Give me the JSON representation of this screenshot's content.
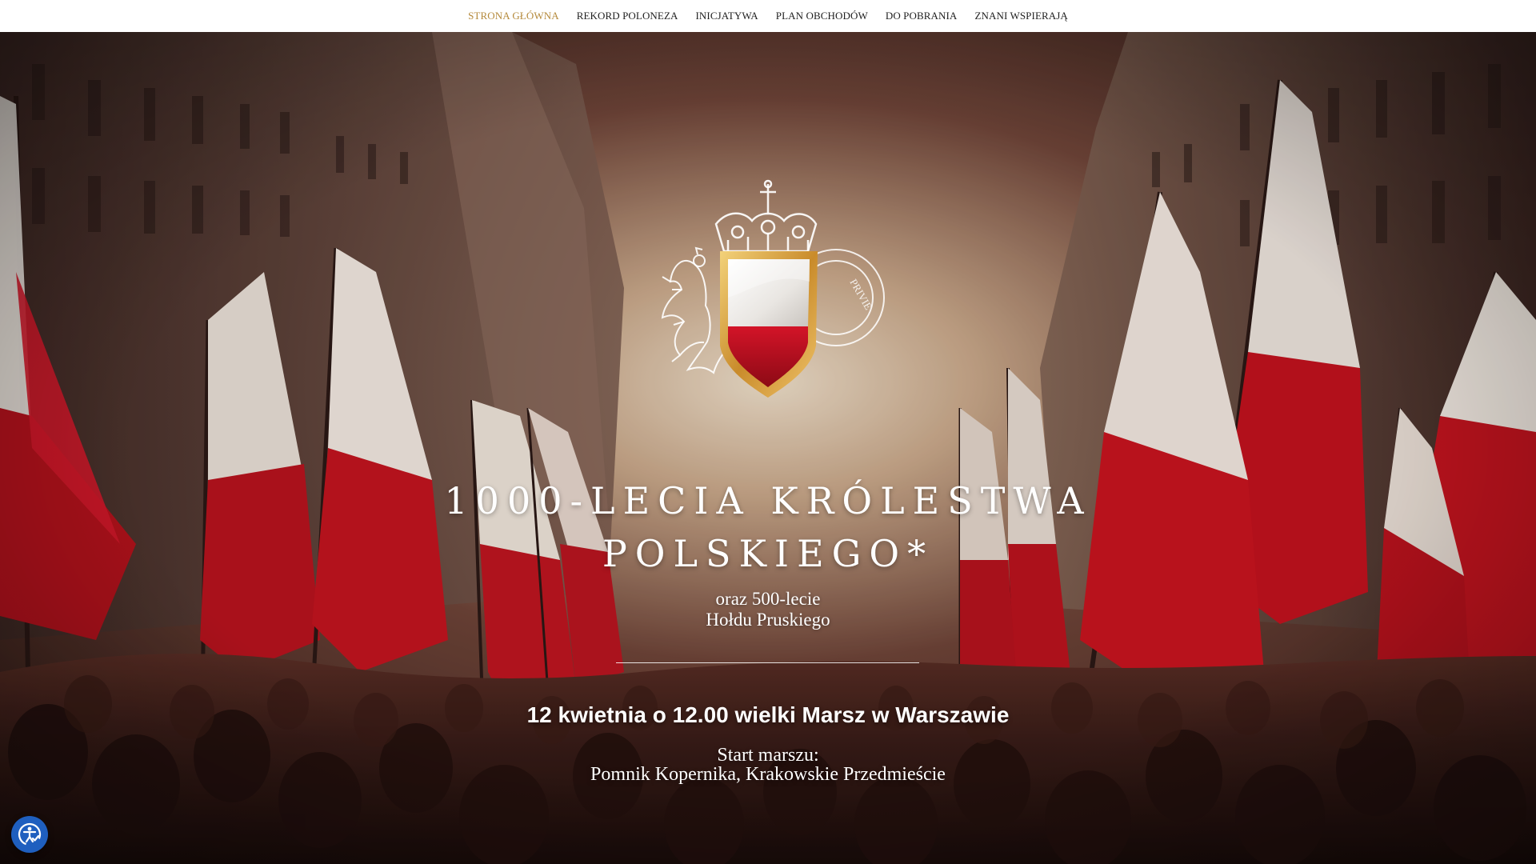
{
  "nav": {
    "items": [
      {
        "label": "STRONA GŁÓWNA",
        "active": true
      },
      {
        "label": "REKORD POLONEZA",
        "active": false
      },
      {
        "label": "INICJATYWA",
        "active": false
      },
      {
        "label": "PLAN OBCHODÓW",
        "active": false
      },
      {
        "label": "DO POBRANIA",
        "active": false
      },
      {
        "label": "ZNANI WSPIERAJĄ",
        "active": false
      }
    ]
  },
  "hero": {
    "title_line1": "1000-LECIA KRÓLESTWA",
    "title_line2": "POLSKIEGO*",
    "subtitle_line1": "oraz 500-lecie",
    "subtitle_line2": "Hołdu Pruskiego",
    "march": "12 kwietnia o 12.00 wielki Marsz w Warszawie",
    "start_line1": "Start marszu:",
    "start_line2": "Pomnik Kopernika, Krakowskie Przedmieście"
  },
  "emblem": {
    "seal_text": "PRIVIE"
  },
  "icons": {
    "emblem": "crowned-shield-emblem-icon",
    "accessibility": "accessibility-icon"
  },
  "colors": {
    "nav_active": "#b58a3c",
    "flag_red": "#c0121f",
    "flag_white": "#f4f2ee",
    "gold": "#d6a23c",
    "accessibility_button": "#1f5fbf"
  }
}
